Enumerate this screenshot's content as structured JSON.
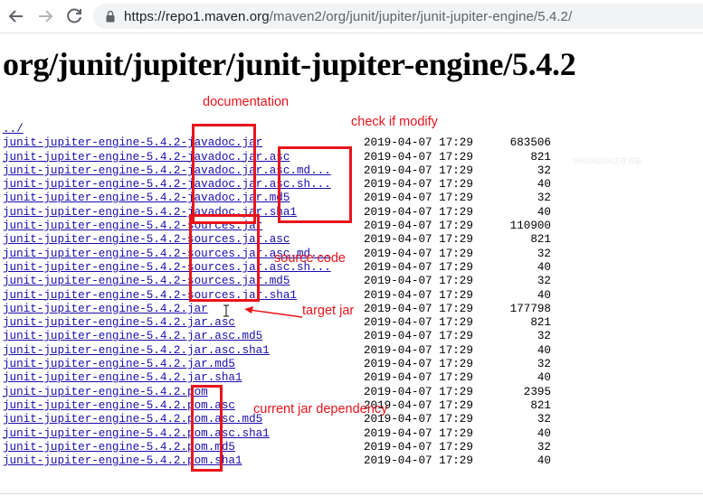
{
  "browser": {
    "url_host": "https://repo1.maven.org",
    "url_path": "/maven2/org/junit/jupiter/junit-jupiter-engine/5.4.2/",
    "back_icon": "arrow-left-icon",
    "forward_icon": "arrow-right-icon",
    "reload_icon": "reload-icon",
    "lock_icon": "lock-icon"
  },
  "page": {
    "title": "org/junit/jupiter/junit-jupiter-engine/5.4.2",
    "parent_link": "../",
    "files": [
      {
        "name": "junit-jupiter-engine-5.4.2-javadoc.jar",
        "date": "2019-04-07 17:29",
        "size": "683506"
      },
      {
        "name": "junit-jupiter-engine-5.4.2-javadoc.jar.asc",
        "date": "2019-04-07 17:29",
        "size": "821"
      },
      {
        "name": "junit-jupiter-engine-5.4.2-javadoc.jar.asc.md...",
        "date": "2019-04-07 17:29",
        "size": "32"
      },
      {
        "name": "junit-jupiter-engine-5.4.2-javadoc.jar.asc.sh...",
        "date": "2019-04-07 17:29",
        "size": "40"
      },
      {
        "name": "junit-jupiter-engine-5.4.2-javadoc.jar.md5",
        "date": "2019-04-07 17:29",
        "size": "32"
      },
      {
        "name": "junit-jupiter-engine-5.4.2-javadoc.jar.sha1",
        "date": "2019-04-07 17:29",
        "size": "40"
      },
      {
        "name": "junit-jupiter-engine-5.4.2-sources.jar",
        "date": "2019-04-07 17:29",
        "size": "110900"
      },
      {
        "name": "junit-jupiter-engine-5.4.2-sources.jar.asc",
        "date": "2019-04-07 17:29",
        "size": "821"
      },
      {
        "name": "junit-jupiter-engine-5.4.2-sources.jar.asc.md...",
        "date": "2019-04-07 17:29",
        "size": "32"
      },
      {
        "name": "junit-jupiter-engine-5.4.2-sources.jar.asc.sh...",
        "date": "2019-04-07 17:29",
        "size": "40"
      },
      {
        "name": "junit-jupiter-engine-5.4.2-sources.jar.md5",
        "date": "2019-04-07 17:29",
        "size": "32"
      },
      {
        "name": "junit-jupiter-engine-5.4.2-sources.jar.sha1",
        "date": "2019-04-07 17:29",
        "size": "40"
      },
      {
        "name": "junit-jupiter-engine-5.4.2.jar",
        "date": "2019-04-07 17:29",
        "size": "177798"
      },
      {
        "name": "junit-jupiter-engine-5.4.2.jar.asc",
        "date": "2019-04-07 17:29",
        "size": "821"
      },
      {
        "name": "junit-jupiter-engine-5.4.2.jar.asc.md5",
        "date": "2019-04-07 17:29",
        "size": "32"
      },
      {
        "name": "junit-jupiter-engine-5.4.2.jar.asc.sha1",
        "date": "2019-04-07 17:29",
        "size": "40"
      },
      {
        "name": "junit-jupiter-engine-5.4.2.jar.md5",
        "date": "2019-04-07 17:29",
        "size": "32"
      },
      {
        "name": "junit-jupiter-engine-5.4.2.jar.sha1",
        "date": "2019-04-07 17:29",
        "size": "40"
      },
      {
        "name": "junit-jupiter-engine-5.4.2.pom",
        "date": "2019-04-07 17:29",
        "size": "2395"
      },
      {
        "name": "junit-jupiter-engine-5.4.2.pom.asc",
        "date": "2019-04-07 17:29",
        "size": "821"
      },
      {
        "name": "junit-jupiter-engine-5.4.2.pom.asc.md5",
        "date": "2019-04-07 17:29",
        "size": "32"
      },
      {
        "name": "junit-jupiter-engine-5.4.2.pom.asc.sha1",
        "date": "2019-04-07 17:29",
        "size": "40"
      },
      {
        "name": "junit-jupiter-engine-5.4.2.pom.md5",
        "date": "2019-04-07 17:29",
        "size": "32"
      },
      {
        "name": "junit-jupiter-engine-5.4.2.pom.sha1",
        "date": "2019-04-07 17:29",
        "size": "40"
      }
    ]
  },
  "annotations": {
    "color": "#e8141b",
    "documentation": "documentation",
    "check_if_modify": "check if modify",
    "source_code": "source code",
    "target_jar": "target jar",
    "current_jar_dependency": "current jar dependency"
  },
  "watermark": "9665949058正在观看"
}
